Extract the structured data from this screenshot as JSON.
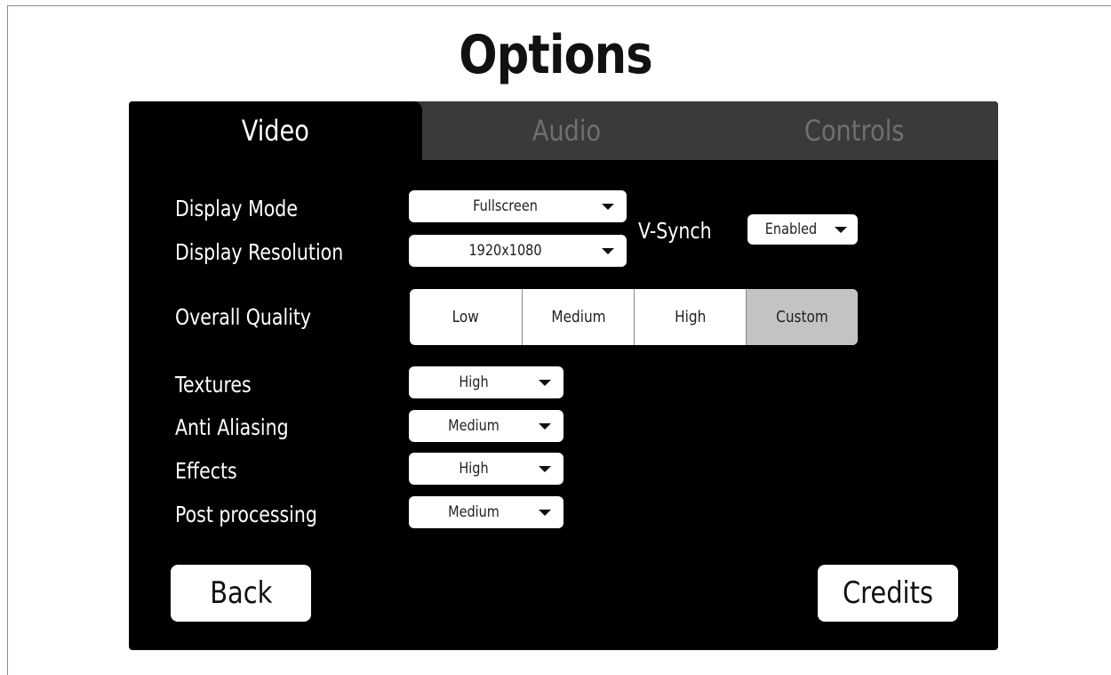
{
  "title": "Options",
  "tabs": [
    {
      "label": "Video",
      "active": true
    },
    {
      "label": "Audio",
      "active": false
    },
    {
      "label": "Controls",
      "active": false
    }
  ],
  "video": {
    "display_mode": {
      "label": "Display Mode",
      "value": "Fullscreen"
    },
    "display_resolution": {
      "label": "Display Resolution",
      "value": "1920x1080"
    },
    "vsynch": {
      "label": "V-Synch",
      "value": "Enabled"
    },
    "overall_quality": {
      "label": "Overall Quality",
      "options": [
        "Low",
        "Medium",
        "High",
        "Custom"
      ],
      "selected": "Custom"
    },
    "textures": {
      "label": "Textures",
      "value": "High"
    },
    "anti_aliasing": {
      "label": "Anti Aliasing",
      "value": "Medium"
    },
    "effects": {
      "label": "Effects",
      "value": "High"
    },
    "post_processing": {
      "label": "Post processing",
      "value": "Medium"
    }
  },
  "buttons": {
    "back": "Back",
    "credits": "Credits"
  },
  "colors": {
    "panel_bg": "#000000",
    "tabbar_bg": "#3a3a3a",
    "inactive_tab_text": "#6f6f6f",
    "selected_quality_bg": "#c3c3c3"
  },
  "icons": {
    "dropdown_caret": "caret-down-icon"
  }
}
